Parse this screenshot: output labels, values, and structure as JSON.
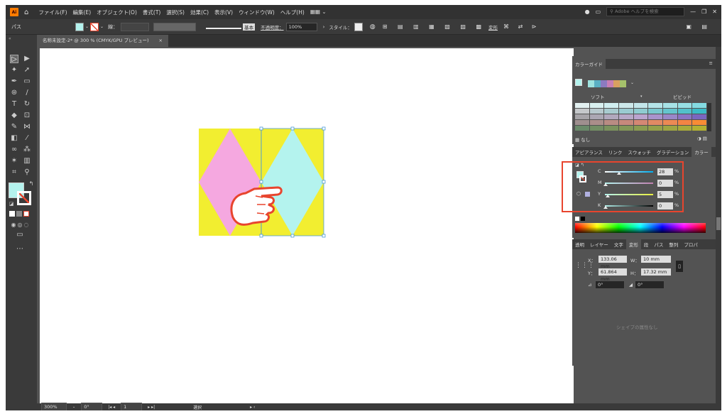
{
  "menubar": {
    "logo": "Ai",
    "menus": [
      "ファイル(F)",
      "編集(E)",
      "オブジェクト(O)",
      "書式(T)",
      "選択(S)",
      "効果(C)",
      "表示(V)",
      "ウィンドウ(W)",
      "ヘルプ(H)"
    ],
    "search_placeholder": "Adobe ヘルプを検索"
  },
  "controlbar": {
    "selection_label": "パス",
    "stroke_label": "線：",
    "brush_label": "基本",
    "opacity_label": "不透明度：",
    "opacity_value": "100%",
    "style_label": "スタイル：",
    "transform_label": "変形"
  },
  "document": {
    "tab_title": "名称未設定-2* @ 300 % (CMYK/GPU プレビュー)",
    "close": "×"
  },
  "statusbar": {
    "zoom": "300%",
    "rotation": "0°",
    "page": "1",
    "tool": "選択"
  },
  "colorguide": {
    "title": "カラーガイド",
    "soft_label": "ソフト",
    "vivid_label": "ビビッド",
    "none_label": "なし",
    "harmony_colors": [
      "#9ee3df",
      "#5ab0c4",
      "#8b7bc0",
      "#c77fb5",
      "#d9a060",
      "#a5c16b"
    ],
    "grid": [
      [
        "#e2f0f0",
        "#d8f0f0",
        "#d0eef0",
        "#cde8ea",
        "#c3e6ea",
        "#b4e4e8",
        "#a6e2e6",
        "#96dfe4",
        "#84dbe2"
      ],
      [
        "#c5c8ca",
        "#b7c9cd",
        "#a8cbcf",
        "#9acbd1",
        "#8fccd1",
        "#79c8cf",
        "#64c5cd",
        "#52c0ca",
        "#3bbac7"
      ],
      [
        "#a6a4a8",
        "#aba7b3",
        "#b1a8bd",
        "#b7a8c8",
        "#baa4cf",
        "#a993cc",
        "#9987c8",
        "#8a74c4",
        "#7a66bf"
      ],
      [
        "#9f8f8f",
        "#ab8e8a",
        "#b98c83",
        "#c7897c",
        "#d58874",
        "#e28a64",
        "#ec8a54",
        "#f48444",
        "#f98c35"
      ],
      [
        "#6a8a6a",
        "#738e64",
        "#7b925d",
        "#839757",
        "#8c9c50",
        "#95a049",
        "#9ea542",
        "#a8aa3a",
        "#b2b032"
      ]
    ]
  },
  "colorpanel": {
    "tabs": [
      "アピアランス",
      "リンク",
      "スウォッチ",
      "グラデーション",
      "カラー"
    ],
    "channels": [
      {
        "name": "C",
        "value": "28",
        "unit": "%",
        "fraction": 0.28
      },
      {
        "name": "M",
        "value": "0",
        "unit": "%",
        "fraction": 0
      },
      {
        "name": "Y",
        "value": "5",
        "unit": "%",
        "fraction": 0.05
      },
      {
        "name": "K",
        "value": "0",
        "unit": "%",
        "fraction": 0
      }
    ],
    "fill_color": "#b4f3ee"
  },
  "transform": {
    "tabs": [
      "透明",
      "レイヤー",
      "文字",
      "変形",
      "段",
      "パス",
      "整列",
      "プロパ"
    ],
    "x_label": "X：",
    "x_value": "133.06 mm",
    "y_label": "Y：",
    "y_value": "61.864 mm",
    "w_label": "W：",
    "w_value": "10 mm",
    "h_label": "H：",
    "h_value": "17.32 mm",
    "angle_value": "0°",
    "shear_value": "0°",
    "no_shape_text": "シェイプの属性なし"
  },
  "artwork": {
    "background": "#f2ee30",
    "left_diamond": "#f5a8e0",
    "right_diamond": "#b4f3ee",
    "highlight": "#e8452e",
    "hand": "#e8452e"
  }
}
